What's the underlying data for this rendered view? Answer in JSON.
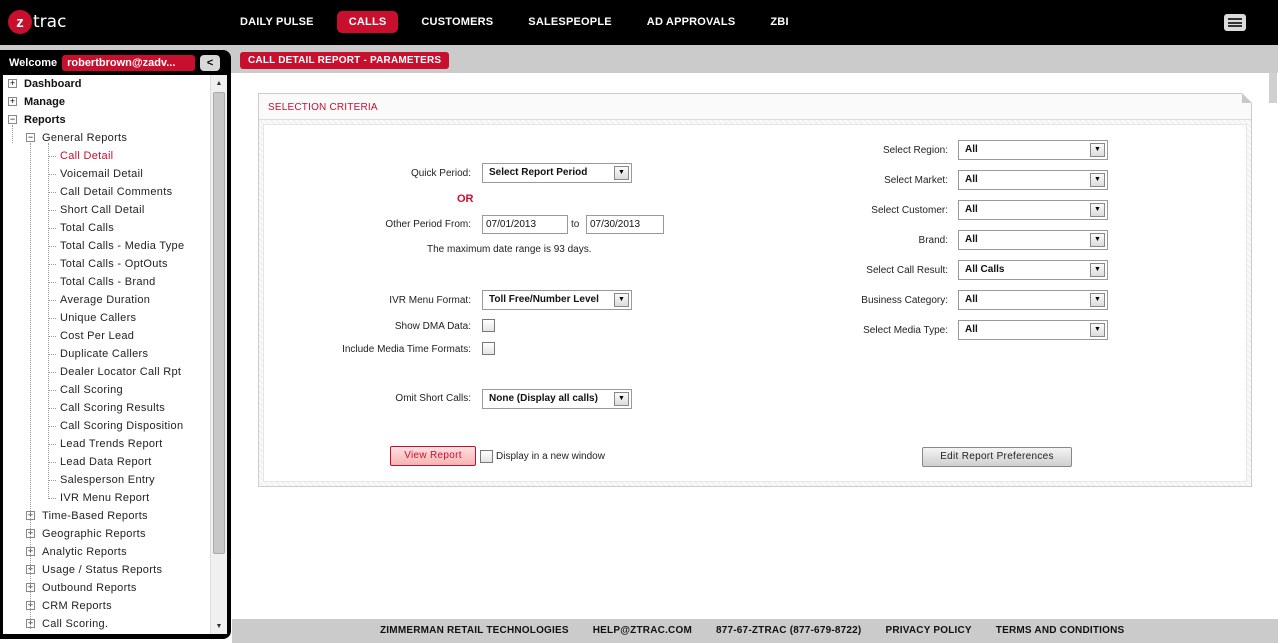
{
  "app": {
    "logo_letter": "z",
    "logo_text": "trac"
  },
  "nav": [
    "DAILY PULSE",
    "CALLS",
    "CUSTOMERS",
    "SALESPEOPLE",
    "AD APPROVALS",
    "ZBI"
  ],
  "nav_active": "CALLS",
  "sidebar": {
    "welcome_label": "Welcome",
    "user": "robertbrown@zadv...",
    "collapse_label": "<",
    "top_items": [
      "Dashboard",
      "Manage",
      "Reports"
    ],
    "general_reports_label": "General Reports",
    "general_reports": [
      "Call Detail",
      "Voicemail Detail",
      "Call Detail Comments",
      "Short Call Detail",
      "Total Calls",
      "Total Calls - Media Type",
      "Total Calls - OptOuts",
      "Total Calls - Brand",
      "Average Duration",
      "Unique Callers",
      "Cost Per Lead",
      "Duplicate Callers",
      "Dealer Locator Call Rpt",
      "Call Scoring",
      "Call Scoring Results",
      "Call Scoring Disposition",
      "Lead Trends Report",
      "Lead Data Report",
      "Salesperson Entry",
      "IVR Menu Report"
    ],
    "active_report": "Call Detail",
    "other_groups": [
      "Time-Based Reports",
      "Geographic Reports",
      "Analytic Reports",
      "Usage / Status Reports",
      "Outbound Reports",
      "CRM Reports",
      "Call Scoring."
    ]
  },
  "section_tab": "CALL DETAIL REPORT - PARAMETERS",
  "panel": {
    "title": "SELECTION CRITERIA",
    "quick_period_label": "Quick Period:",
    "quick_period_value": "Select Report Period",
    "or_text": "OR",
    "other_period_label": "Other Period From:",
    "from_date": "07/01/2013",
    "to_label": "to",
    "to_date": "07/30/2013",
    "max_range_note": "The maximum date range is 93 days.",
    "ivr_label": "IVR Menu Format:",
    "ivr_value": "Toll Free/Number Level",
    "show_dma_label": "Show DMA Data:",
    "include_media_label": "Include Media Time Formats:",
    "omit_short_label": "Omit Short Calls:",
    "omit_short_value": "None (Display all calls)",
    "view_report_label": "View Report",
    "new_window_label": "Display in a new window",
    "edit_prefs_label": "Edit Report Preferences",
    "right_fields": [
      {
        "label": "Select Region:",
        "value": "All"
      },
      {
        "label": "Select Market:",
        "value": "All"
      },
      {
        "label": "Select Customer:",
        "value": "All"
      },
      {
        "label": "Brand:",
        "value": "All"
      },
      {
        "label": "Select Call Result:",
        "value": "All Calls"
      },
      {
        "label": "Business Category:",
        "value": "All"
      },
      {
        "label": "Select Media Type:",
        "value": "All"
      }
    ]
  },
  "footer": [
    "ZIMMERMAN RETAIL TECHNOLOGIES",
    "HELP@ZTRAC.COM",
    "877-67-ZTRAC (877-679-8722)",
    "PRIVACY POLICY",
    "TERMS AND CONDITIONS"
  ]
}
